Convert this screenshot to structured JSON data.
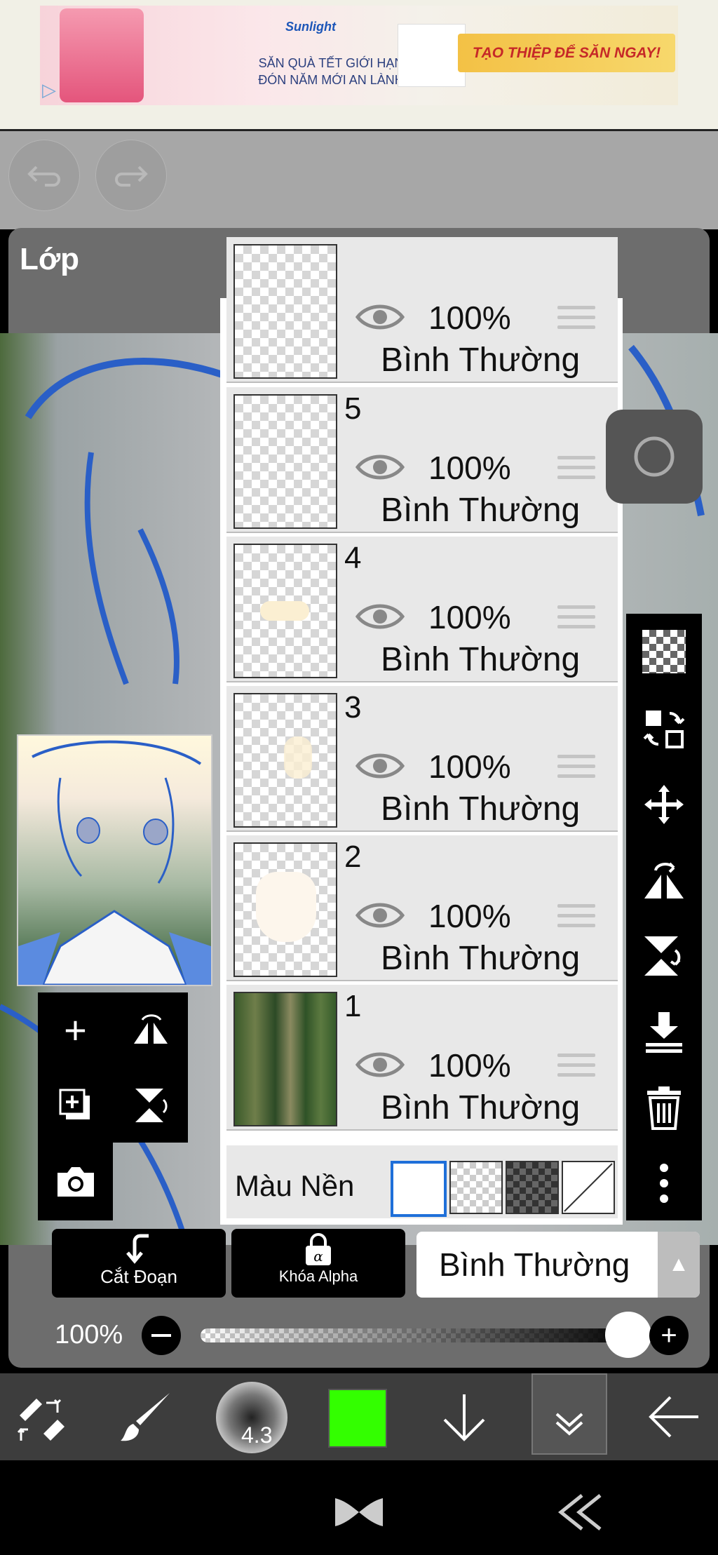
{
  "ad": {
    "line1": "SĂN QUÀ TẾT GIỚI HẠN",
    "line2": "ĐÓN NĂM MỚI AN LÀNH",
    "cta": "TẠO THIỆP ĐỂ SĂN NGAY!",
    "brand": "Sunlight"
  },
  "panel": {
    "title": "Lớp"
  },
  "layers": [
    {
      "number": "",
      "opacity": "100%",
      "mode": "Bình Thường"
    },
    {
      "number": "5",
      "opacity": "100%",
      "mode": "Bình Thường"
    },
    {
      "number": "4",
      "opacity": "100%",
      "mode": "Bình Thường"
    },
    {
      "number": "3",
      "opacity": "100%",
      "mode": "Bình Thường"
    },
    {
      "number": "2",
      "opacity": "100%",
      "mode": "Bình Thường"
    },
    {
      "number": "1",
      "opacity": "100%",
      "mode": "Bình Thường"
    }
  ],
  "background": {
    "label": "Màu Nền"
  },
  "controls": {
    "clip_label": "Cắt Đoạn",
    "alpha_lock_label": "Khóa Alpha",
    "blend_mode": "Bình Thường",
    "opacity_label": "100%",
    "opacity_value": 1.0
  },
  "toolbar": {
    "brush_size": "4.3",
    "color": "#33ff00"
  },
  "colors": {
    "panel": "#6d6d6d",
    "accent": "#1e6fd9"
  }
}
